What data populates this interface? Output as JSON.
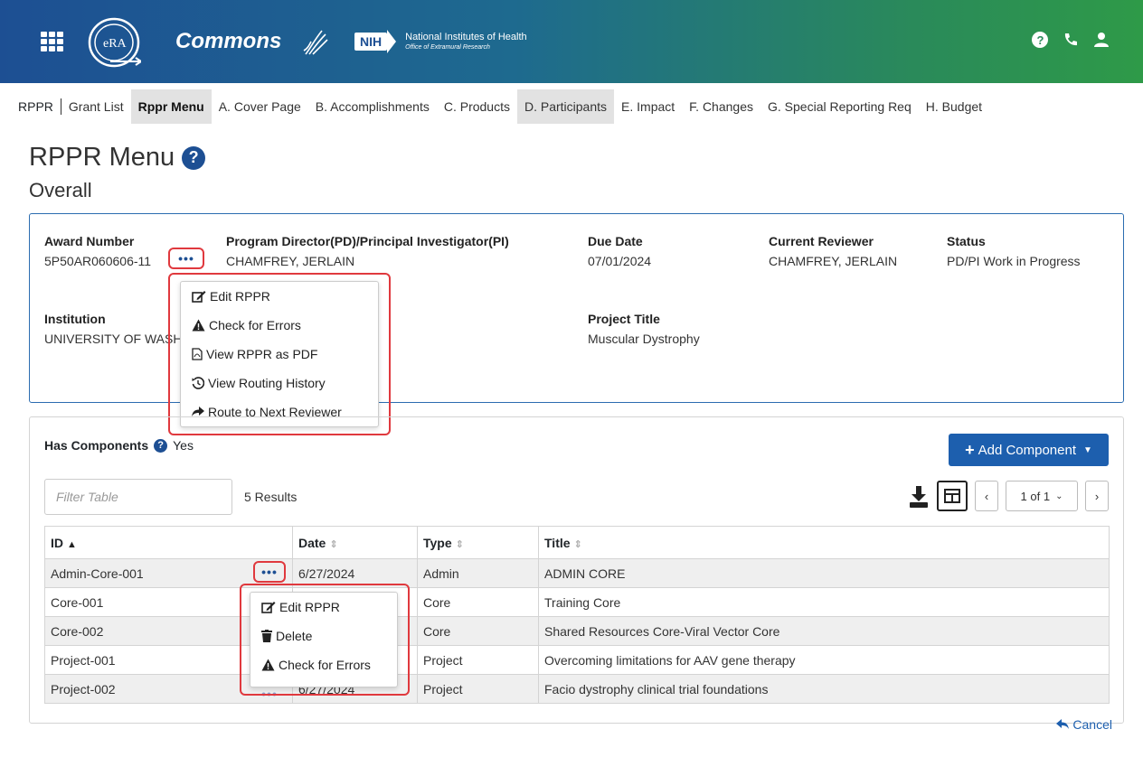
{
  "header": {
    "logo_text": "eRA",
    "app_name": "Commons",
    "nih_badge": "NIH",
    "nih_line1": "National Institutes of Health",
    "nih_line2": "Office of Extramural Research"
  },
  "nav": {
    "brand": "RPPR",
    "items": [
      "Grant List",
      "Rppr Menu",
      "A. Cover Page",
      "B. Accomplishments",
      "C. Products",
      "D. Participants",
      "E. Impact",
      "F. Changes",
      "G. Special Reporting Req",
      "H. Budget"
    ]
  },
  "page": {
    "title": "RPPR Menu",
    "subtitle": "Overall"
  },
  "overall": {
    "award_label": "Award Number",
    "award_value": "5P50AR060606-11",
    "pi_label": "Program Director(PD)/Principal Investigator(PI)",
    "pi_value": "CHAMFREY, JERLAIN",
    "due_label": "Due Date",
    "due_value": "07/01/2024",
    "reviewer_label": "Current Reviewer",
    "reviewer_value": "CHAMFREY, JERLAIN",
    "status_label": "Status",
    "status_value": "PD/PI Work in Progress",
    "institution_label": "Institution",
    "institution_value": "UNIVERSITY OF WAS",
    "institution_value_tail": "H",
    "project_label": "Project Title",
    "project_value": "Muscular Dystrophy",
    "more_label": "•••"
  },
  "overall_menu": {
    "items": [
      "Edit RPPR",
      "Check for Errors",
      "View RPPR as PDF",
      "View Routing History",
      "Route to Next Reviewer"
    ]
  },
  "components": {
    "has_label": "Has Components",
    "has_value": "Yes",
    "add_button": "Add Component",
    "filter_placeholder": "Filter Table",
    "results": "5 Results",
    "pager": "1 of 1",
    "columns": [
      "ID",
      "Date",
      "Type",
      "Title"
    ],
    "rows": [
      {
        "id": "Admin-Core-001",
        "date": "6/27/2024",
        "type": "Admin",
        "title": "ADMIN CORE"
      },
      {
        "id": "Core-001",
        "date": "",
        "type": "Core",
        "title": "Training Core"
      },
      {
        "id": "Core-002",
        "date": "",
        "type": "Core",
        "title": "Shared Resources Core-Viral Vector Core"
      },
      {
        "id": "Project-001",
        "date": "",
        "type": "Project",
        "title": "Overcoming limitations for AAV gene therapy"
      },
      {
        "id": "Project-002",
        "date": "6/27/2024",
        "type": "Project",
        "title": "Facio dystrophy clinical trial foundations"
      }
    ]
  },
  "row_menu": {
    "items": [
      "Edit RPPR",
      "Delete",
      "Check for Errors"
    ]
  },
  "footer": {
    "cancel": "Cancel"
  },
  "colors": {
    "primary": "#1d5fae",
    "highlight": "#e0393e"
  }
}
